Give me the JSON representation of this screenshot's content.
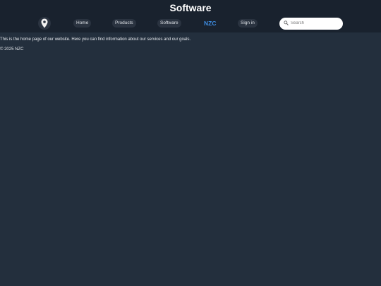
{
  "header": {
    "title": "Software",
    "icon": "location-pin-icon",
    "nav": {
      "home": "Home",
      "products": "Products",
      "software": "Software",
      "brand": "NZC",
      "sign_in": "Sign in"
    },
    "search": {
      "placeholder": "Search"
    }
  },
  "main": {
    "intro": "This is the home page of our website. Here you can find information about our services and our goals."
  },
  "footer": {
    "copyright": "© 2025 NZC"
  },
  "colors": {
    "background": "#232f3d",
    "header_background": "#19222e",
    "accent": "#3d8be0"
  }
}
